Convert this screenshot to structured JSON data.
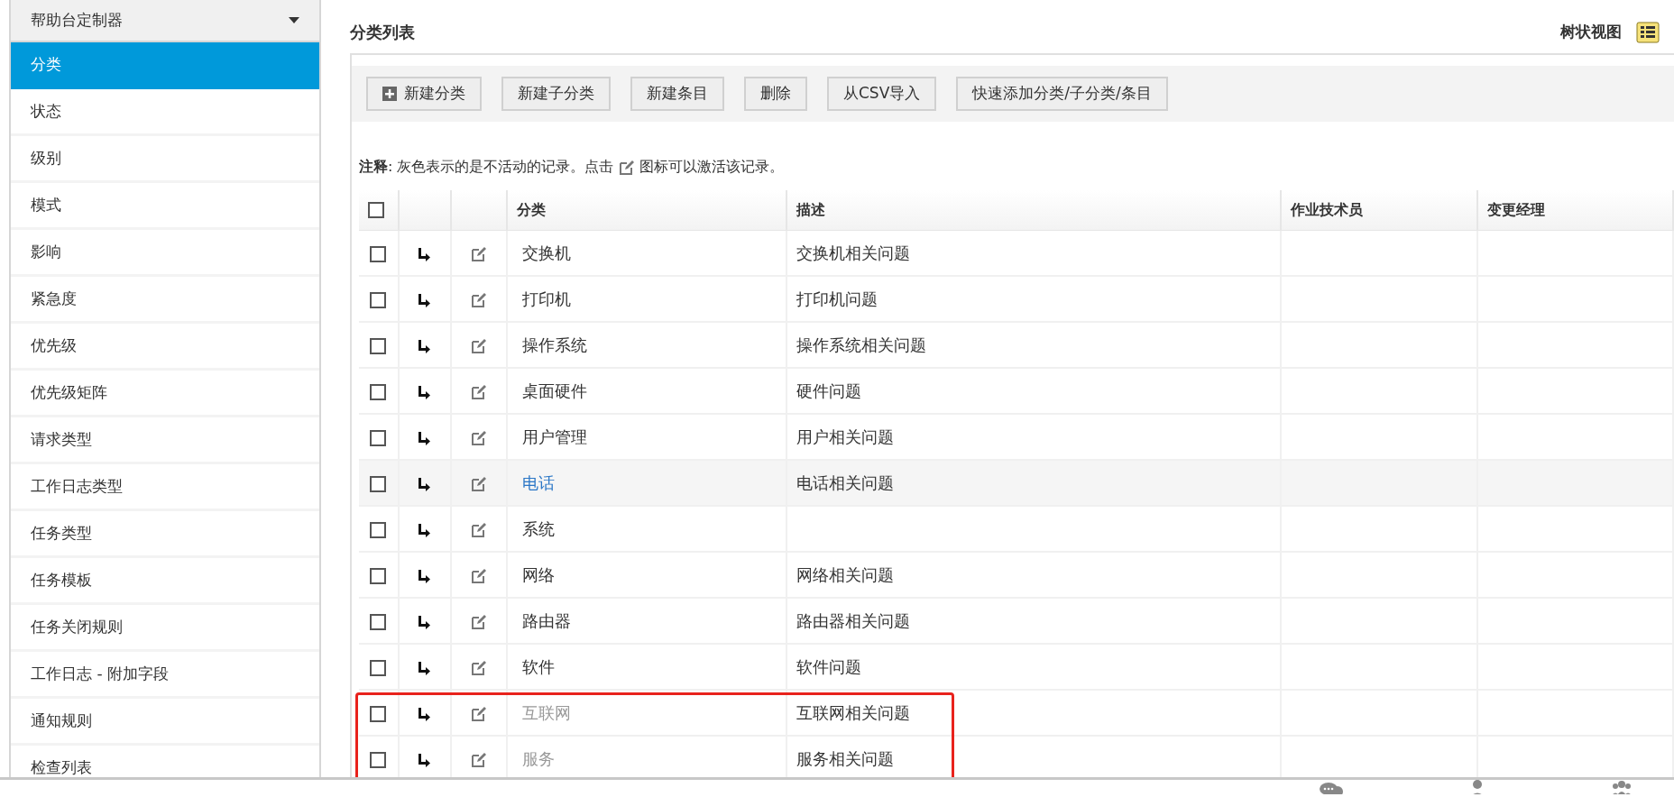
{
  "sidebar": {
    "header": "帮助台定制器",
    "items": [
      {
        "label": "分类",
        "selected": true
      },
      {
        "label": "状态",
        "selected": false
      },
      {
        "label": "级别",
        "selected": false
      },
      {
        "label": "模式",
        "selected": false
      },
      {
        "label": "影响",
        "selected": false
      },
      {
        "label": "紧急度",
        "selected": false
      },
      {
        "label": "优先级",
        "selected": false
      },
      {
        "label": "优先级矩阵",
        "selected": false
      },
      {
        "label": "请求类型",
        "selected": false
      },
      {
        "label": "工作日志类型",
        "selected": false
      },
      {
        "label": "任务类型",
        "selected": false
      },
      {
        "label": "任务模板",
        "selected": false
      },
      {
        "label": "任务关闭规则",
        "selected": false
      },
      {
        "label": "工作日志 - 附加字段",
        "selected": false
      },
      {
        "label": "通知规则",
        "selected": false
      },
      {
        "label": "检查列表",
        "selected": false
      }
    ]
  },
  "page_title": "分类列表",
  "view_toggle": "树状视图",
  "toolbar": [
    {
      "label": "新建分类",
      "kind": "add"
    },
    {
      "label": "新建子分类",
      "kind": "plain"
    },
    {
      "label": "新建条目",
      "kind": "plain"
    },
    {
      "label": "删除",
      "kind": "plain"
    },
    {
      "label": "从CSV导入",
      "kind": "plain"
    },
    {
      "label": "快速添加分类/子分类/条目",
      "kind": "plain"
    }
  ],
  "note": {
    "label": "注释",
    "text_before": ": 灰色表示的是不活动的记录。点击",
    "text_after": "图标可以激活该记录。"
  },
  "table": {
    "select_all_checked": false,
    "columns": [
      "分类",
      "描述",
      "作业技术员",
      "变更经理"
    ],
    "rows": [
      {
        "category": "交换机",
        "description": "交换机相关问题",
        "checked": false,
        "active": true,
        "hovered": false,
        "flagged": false
      },
      {
        "category": "打印机",
        "description": "打印机问题",
        "checked": false,
        "active": true,
        "hovered": false,
        "flagged": false
      },
      {
        "category": "操作系统",
        "description": "操作系统相关问题",
        "checked": false,
        "active": true,
        "hovered": false,
        "flagged": false
      },
      {
        "category": "桌面硬件",
        "description": "硬件问题",
        "checked": false,
        "active": true,
        "hovered": false,
        "flagged": false
      },
      {
        "category": "用户管理",
        "description": "用户相关问题",
        "checked": false,
        "active": true,
        "hovered": false,
        "flagged": false
      },
      {
        "category": "电话",
        "description": "电话相关问题",
        "checked": false,
        "active": true,
        "hovered": true,
        "flagged": false
      },
      {
        "category": "系统",
        "checked": false,
        "active": true,
        "hovered": false,
        "flagged": false
      },
      {
        "category": "网络",
        "description": "网络相关问题",
        "checked": false,
        "active": true,
        "hovered": false,
        "flagged": false
      },
      {
        "category": "路由器",
        "description": "路由器相关问题",
        "checked": false,
        "active": true,
        "hovered": false,
        "flagged": false
      },
      {
        "category": "软件",
        "description": "软件问题",
        "checked": false,
        "active": true,
        "hovered": false,
        "flagged": false
      },
      {
        "category": "互联网",
        "description": "互联网相关问题",
        "checked": false,
        "active": false,
        "hovered": false,
        "flagged": true
      },
      {
        "category": "服务",
        "description": "服务相关问题",
        "checked": false,
        "active": false,
        "hovered": false,
        "flagged": true
      }
    ]
  }
}
